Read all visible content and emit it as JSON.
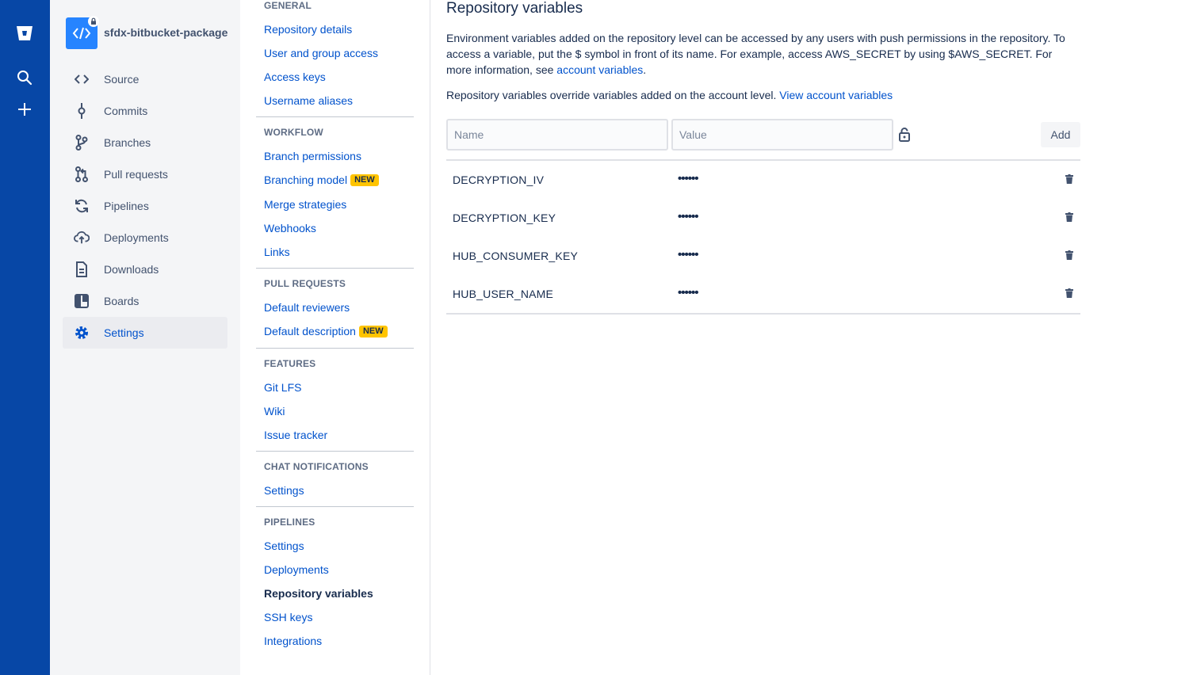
{
  "repo": {
    "name": "sfdx-bitbucket-package"
  },
  "sidebar": {
    "items": [
      {
        "label": "Source",
        "icon": "source-code-icon"
      },
      {
        "label": "Commits",
        "icon": "commit-icon"
      },
      {
        "label": "Branches",
        "icon": "branch-icon"
      },
      {
        "label": "Pull requests",
        "icon": "pull-request-icon"
      },
      {
        "label": "Pipelines",
        "icon": "pipelines-icon"
      },
      {
        "label": "Deployments",
        "icon": "deployments-icon"
      },
      {
        "label": "Downloads",
        "icon": "downloads-icon"
      },
      {
        "label": "Boards",
        "icon": "boards-icon"
      },
      {
        "label": "Settings",
        "icon": "gear-icon",
        "active": true
      }
    ]
  },
  "settings_menu": {
    "general": {
      "heading": "GENERAL",
      "links": [
        "Repository details",
        "User and group access",
        "Access keys",
        "Username aliases"
      ]
    },
    "workflow": {
      "heading": "WORKFLOW",
      "links": [
        "Branch permissions",
        "Branching model",
        "Merge strategies",
        "Webhooks",
        "Links"
      ]
    },
    "pull_requests": {
      "heading": "PULL REQUESTS",
      "links": [
        "Default reviewers",
        "Default description"
      ]
    },
    "features": {
      "heading": "FEATURES",
      "links": [
        "Git LFS",
        "Wiki",
        "Issue tracker"
      ]
    },
    "chat": {
      "heading": "CHAT NOTIFICATIONS",
      "links": [
        "Settings"
      ]
    },
    "pipelines": {
      "heading": "PIPELINES",
      "links": [
        "Settings",
        "Deployments",
        "Repository variables",
        "SSH keys",
        "Integrations"
      ]
    },
    "new_badge": "NEW"
  },
  "main": {
    "title": "Repository variables",
    "desc_part1": "Environment variables added on the repository level can be accessed by any users with push permissions in the repository. To access a variable, put the $ symbol in front of its name. For example, access AWS_SECRET by using $AWS_SECRET. For more information, see ",
    "desc_link": "account variables",
    "desc_end": ".",
    "override_text": "Repository variables override variables added on the account level. ",
    "override_link": "View account variables",
    "name_placeholder": "Name",
    "value_placeholder": "Value",
    "add_label": "Add",
    "variables": [
      {
        "name": "DECRYPTION_IV",
        "value": "••••••"
      },
      {
        "name": "DECRYPTION_KEY",
        "value": "••••••"
      },
      {
        "name": "HUB_CONSUMER_KEY",
        "value": "••••••"
      },
      {
        "name": "HUB_USER_NAME",
        "value": "••••••"
      }
    ]
  }
}
